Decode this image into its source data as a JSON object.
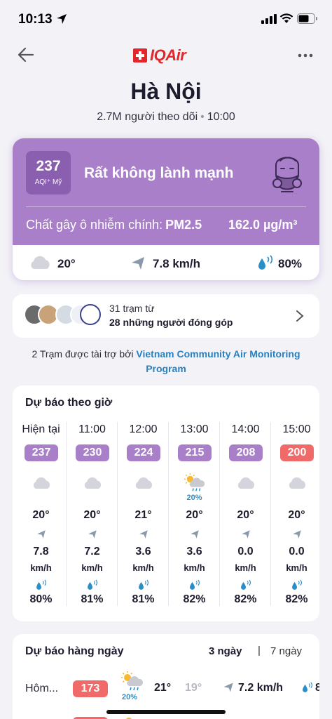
{
  "status_bar": {
    "time": "10:13"
  },
  "header": {
    "brand": "IQAir"
  },
  "city": {
    "name": "Hà Nội",
    "followers": "2.7M người theo dõi",
    "updated": "10:00"
  },
  "aqi": {
    "value": "237",
    "unit": "AQI⁺ Mỹ",
    "status": "Rất không lành mạnh",
    "pollutant_label": "Chất gây ô nhiễm chính:",
    "pollutant": "PM2.5",
    "concentration": "162.0 µg/m³",
    "color": "#a87fc8"
  },
  "current_weather": {
    "temp": "20°",
    "wind": "7.8 km/h",
    "humidity": "80%"
  },
  "stations": {
    "line1": "31 trạm từ",
    "line2": "28 những người đóng góp"
  },
  "sponsor": {
    "prefix": "2 Trạm được tài trợ bởi",
    "name": "Vietnam Community Air Monitoring Program"
  },
  "hourly": {
    "title": "Dự báo theo giờ",
    "hours": [
      {
        "time": "Hiện tại",
        "aqi": "237",
        "color": "#a87fc8",
        "icon": "cloud-icon",
        "rain": "",
        "temp": "20°",
        "wind": "7.8",
        "wind_unit": "km/h",
        "humidity": "80%"
      },
      {
        "time": "11:00",
        "aqi": "230",
        "color": "#a87fc8",
        "icon": "cloud-icon",
        "rain": "",
        "temp": "20°",
        "wind": "7.2",
        "wind_unit": "km/h",
        "humidity": "81%"
      },
      {
        "time": "12:00",
        "aqi": "224",
        "color": "#a87fc8",
        "icon": "cloud-icon",
        "rain": "",
        "temp": "21°",
        "wind": "3.6",
        "wind_unit": "km/h",
        "humidity": "81%"
      },
      {
        "time": "13:00",
        "aqi": "215",
        "color": "#a87fc8",
        "icon": "sun-rain-icon",
        "rain": "20%",
        "temp": "20°",
        "wind": "3.6",
        "wind_unit": "km/h",
        "humidity": "82%"
      },
      {
        "time": "14:00",
        "aqi": "208",
        "color": "#a87fc8",
        "icon": "cloud-icon",
        "rain": "",
        "temp": "20°",
        "wind": "0.0",
        "wind_unit": "km/h",
        "humidity": "82%"
      },
      {
        "time": "15:00",
        "aqi": "200",
        "color": "#f06a6a",
        "icon": "cloud-icon",
        "rain": "",
        "temp": "20°",
        "wind": "0.0",
        "wind_unit": "km/h",
        "humidity": "82%"
      }
    ]
  },
  "daily": {
    "title": "Dự báo hàng ngày",
    "tab_3": "3 ngày",
    "separator": "|",
    "tab_7": "7 ngày",
    "days": [
      {
        "day": "Hôm...",
        "aqi": "173",
        "color": "#f06a6a",
        "icon": "sun-rain-icon",
        "rain": "20%",
        "high": "21°",
        "low": "19°",
        "wind": "7.2 km/h",
        "humidity": "8"
      }
    ]
  }
}
